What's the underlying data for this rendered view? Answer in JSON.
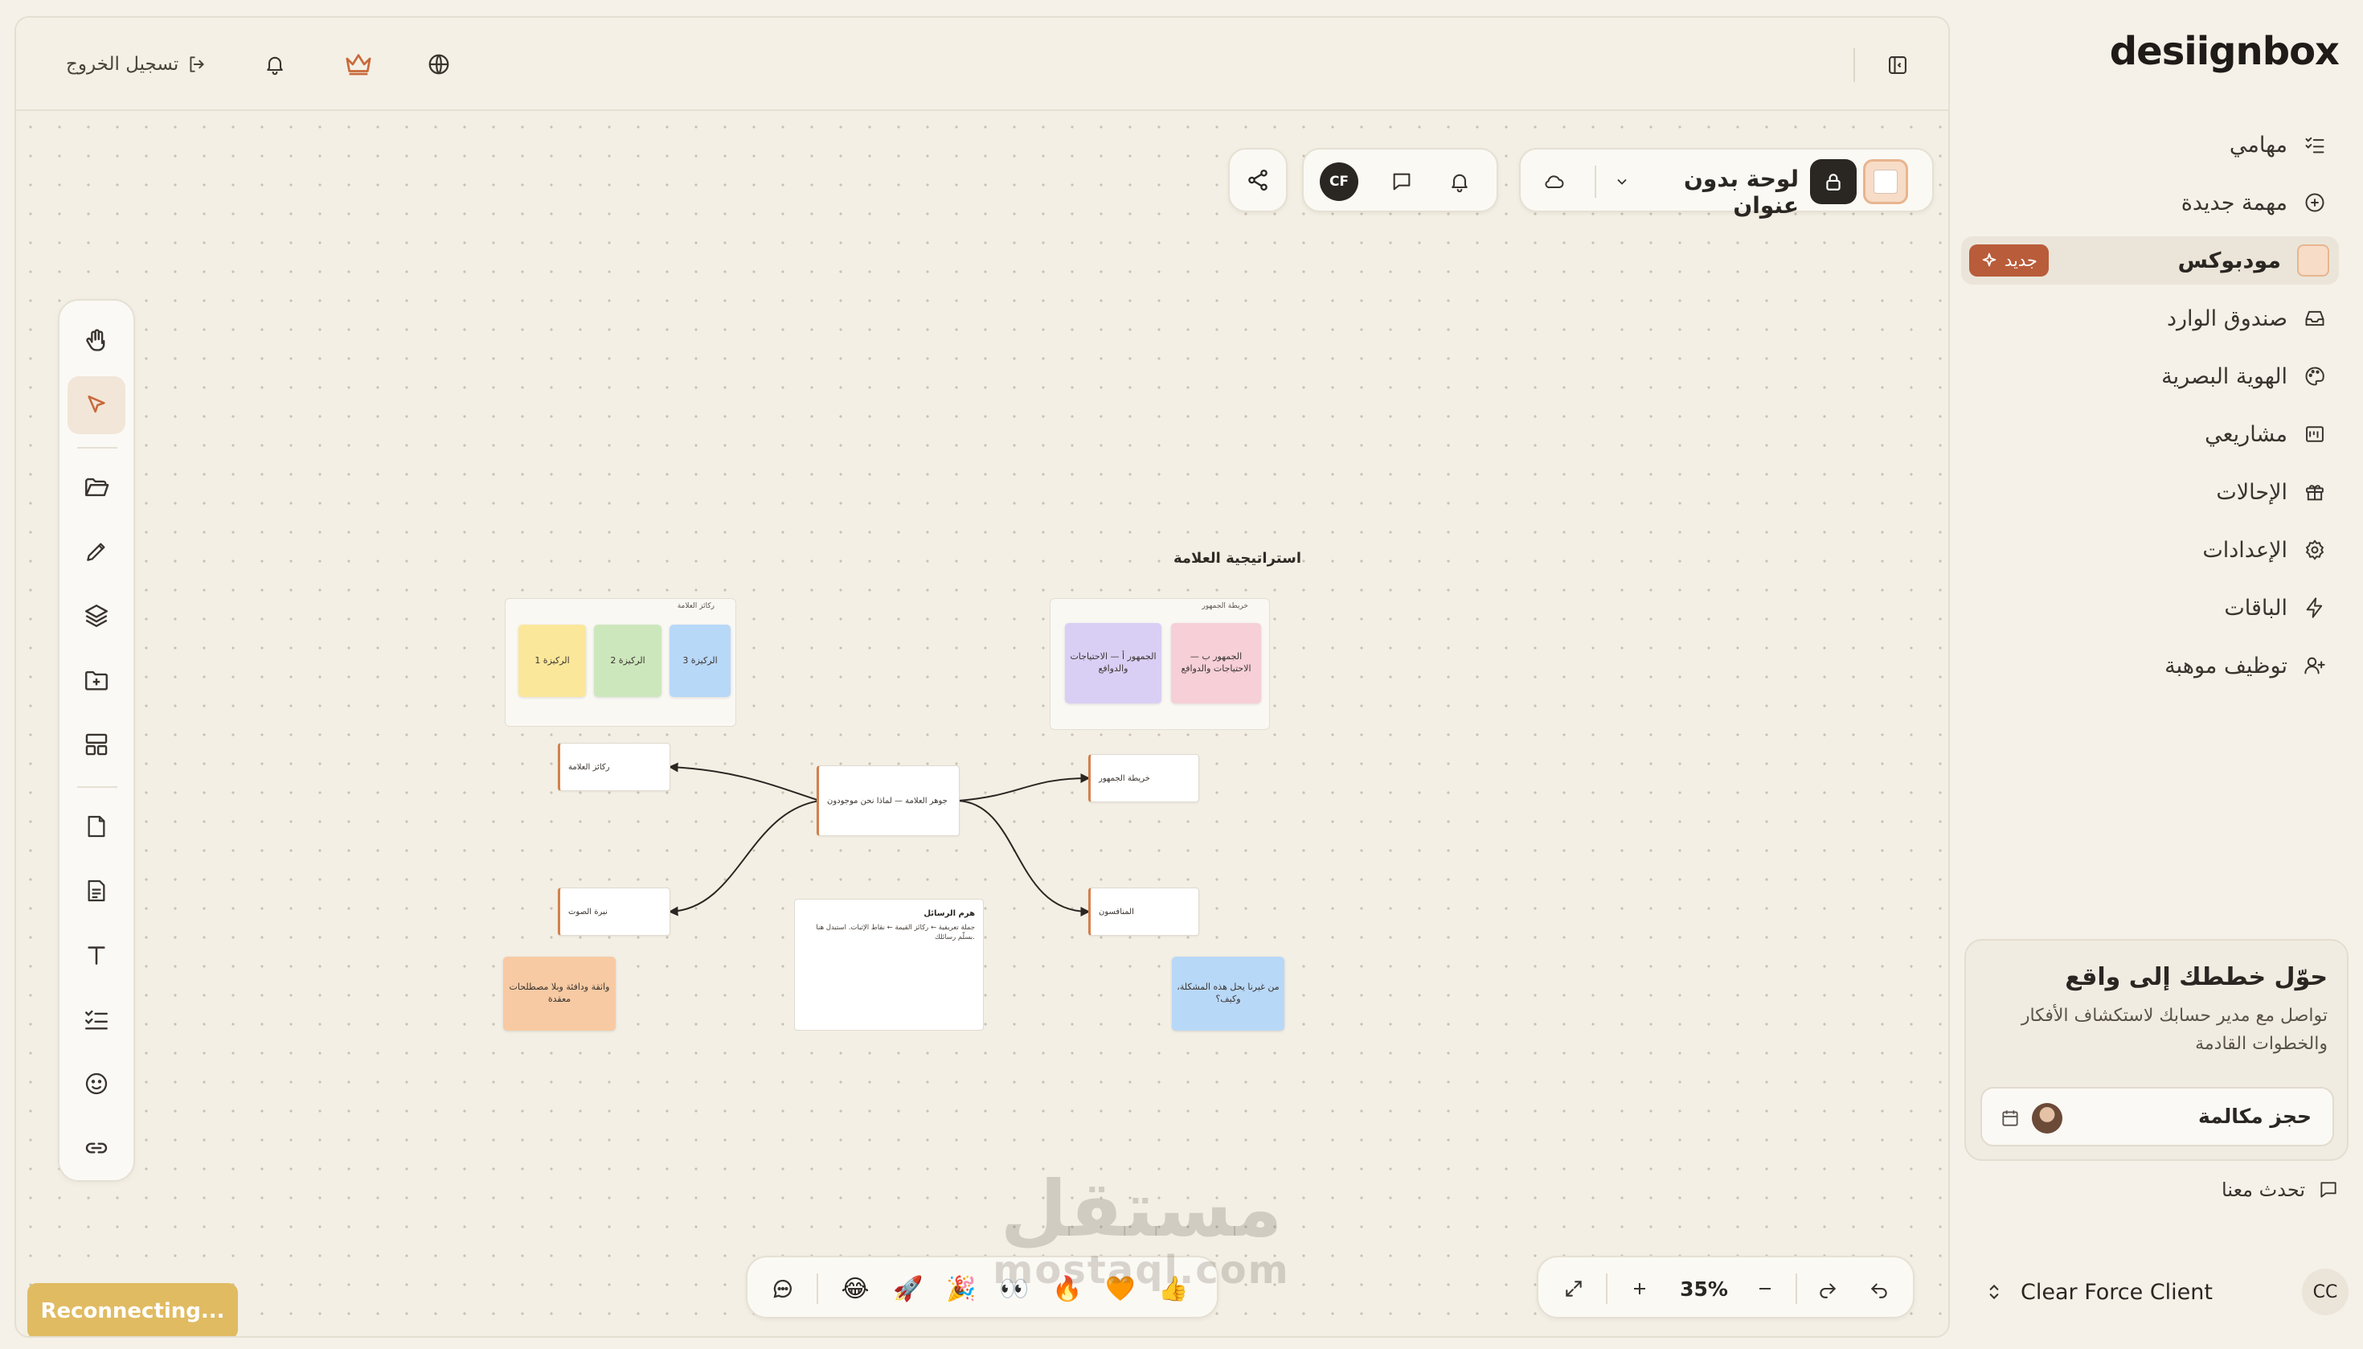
{
  "brand": {
    "logo_text": "desiignbox"
  },
  "topbar": {
    "logout_label": "تسجيل الخروج"
  },
  "board": {
    "title": "لوحة بدون عنوان",
    "avatar_initials": "CF",
    "zoom": "35%",
    "reconnect_label": "Reconnecting...",
    "reactions": [
      "👍",
      "🧡",
      "🔥",
      "👀",
      "🎉",
      "🚀",
      "😂"
    ]
  },
  "canvas": {
    "section_title": "استراتيجية العلامة",
    "frame_pillars_title": "ركائز العلامة",
    "frame_audience_title": "خريطة الجمهور",
    "sticky_pillar_1": "الركيزة 1",
    "sticky_pillar_2": "الركيزة 2",
    "sticky_pillar_3": "الركيزة 3",
    "sticky_audience_a": "الجمهور أ — الاحتياجات والدوافع",
    "sticky_audience_b": "الجمهور ب — الاحتياجات والدوافع",
    "sticky_tone": "واثقة ودافئة وبلا مصطلحات معقدة",
    "sticky_question": "من غيرنا يحل هذه المشكلة، وكيف؟",
    "node_center": "جوهر العلامة — لماذا نحن موجودون",
    "node_pillars": "ركائز العلامة",
    "node_voice": "نبرة الصوت",
    "node_audience": "خريطة الجمهور",
    "node_competitors": "المنافسون",
    "message_title": "هرم الرسائل",
    "message_body": "جملة تعريفية ← ركائز القيمة ← نقاط الإثبات. استبدل هنا بسلّم رسائلك."
  },
  "sidebar": {
    "items": [
      {
        "label": "مهامي",
        "icon": "tasks-icon"
      },
      {
        "label": "مهمة جديدة",
        "icon": "plus-circle-icon"
      },
      {
        "label": "مودبوكس",
        "icon": "moodbox-icon",
        "badge": "جديد",
        "active": true
      },
      {
        "label": "صندوق الوارد",
        "icon": "inbox-icon"
      },
      {
        "label": "الهوية البصرية",
        "icon": "palette-icon"
      },
      {
        "label": "مشاريعي",
        "icon": "projects-icon"
      },
      {
        "label": "الإحالات",
        "icon": "gift-icon"
      },
      {
        "label": "الإعدادات",
        "icon": "gear-icon"
      },
      {
        "label": "الباقات",
        "icon": "bolt-icon"
      },
      {
        "label": "توظيف موهبة",
        "icon": "user-plus-icon"
      }
    ],
    "promo": {
      "title": "حوّل خططك إلى واقع",
      "body": "تواصل مع مدير حسابك لاستكشاف الأفكار والخطوات القادمة",
      "cta": "حجز مكالمة"
    },
    "chat_label": "تحدث معنا",
    "client_name": "Clear Force Client",
    "client_initials": "CC"
  },
  "watermark": {
    "arabic": "مستقل",
    "latin": "mostaql.com"
  },
  "colors": {
    "accent": "#c8693a",
    "badge": "#b95c3a",
    "dark": "#2a2622",
    "reconnect": "#e0bb62"
  }
}
